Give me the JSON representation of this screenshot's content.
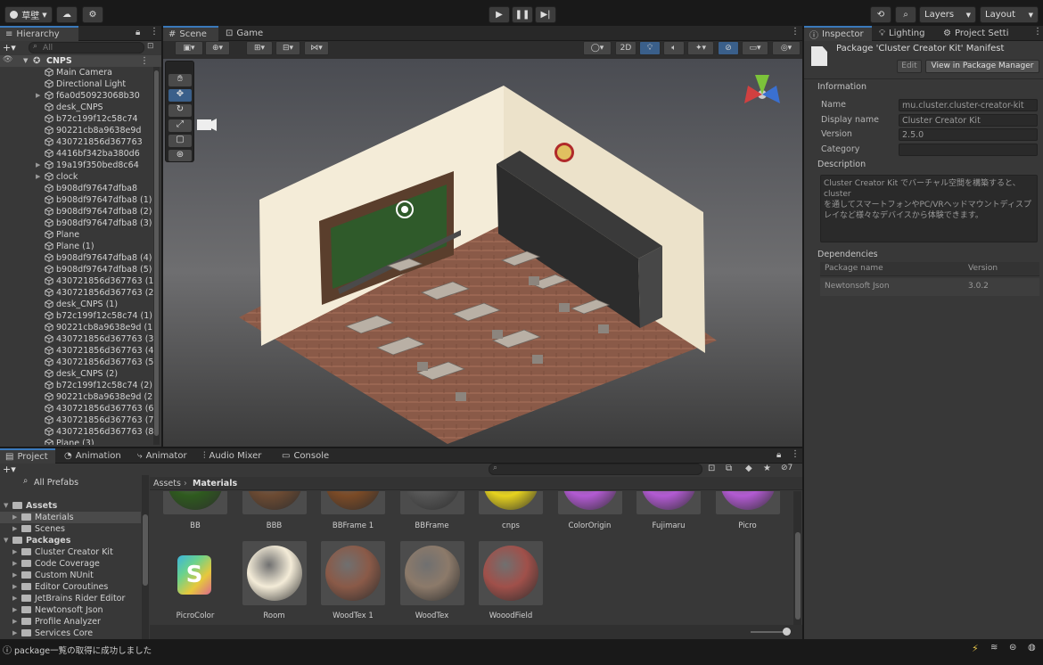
{
  "toolbar": {
    "account_label": "草壁",
    "layers_label": "Layers",
    "layout_label": "Layout"
  },
  "hierarchy": {
    "tab": "Hierarchy",
    "search_placeholder": "All",
    "root": "CNPS",
    "items": [
      {
        "label": "Main Camera",
        "expandable": false
      },
      {
        "label": "Directional Light",
        "expandable": false
      },
      {
        "label": "f6a0d50923068b30",
        "expandable": true
      },
      {
        "label": "desk_CNPS",
        "expandable": false
      },
      {
        "label": "b72c199f12c58c74",
        "expandable": false
      },
      {
        "label": "90221cb8a9638e9d",
        "expandable": false
      },
      {
        "label": "430721856d367763",
        "expandable": false
      },
      {
        "label": "4416bf342ba380d6",
        "expandable": false
      },
      {
        "label": "19a19f350bed8c64",
        "expandable": true
      },
      {
        "label": "clock",
        "expandable": true
      },
      {
        "label": "b908df97647dfba8",
        "expandable": false
      },
      {
        "label": "b908df97647dfba8 (1)",
        "expandable": false
      },
      {
        "label": "b908df97647dfba8 (2)",
        "expandable": false
      },
      {
        "label": "b908df97647dfba8 (3)",
        "expandable": false
      },
      {
        "label": "Plane",
        "expandable": false
      },
      {
        "label": "Plane (1)",
        "expandable": false
      },
      {
        "label": "b908df97647dfba8 (4)",
        "expandable": false
      },
      {
        "label": "b908df97647dfba8 (5)",
        "expandable": false
      },
      {
        "label": "430721856d367763 (1",
        "expandable": false
      },
      {
        "label": "430721856d367763 (2",
        "expandable": false
      },
      {
        "label": "desk_CNPS (1)",
        "expandable": false
      },
      {
        "label": "b72c199f12c58c74 (1)",
        "expandable": false
      },
      {
        "label": "90221cb8a9638e9d (1)",
        "expandable": false
      },
      {
        "label": "430721856d367763 (3",
        "expandable": false
      },
      {
        "label": "430721856d367763 (4",
        "expandable": false
      },
      {
        "label": "430721856d367763 (5",
        "expandable": false
      },
      {
        "label": "desk_CNPS (2)",
        "expandable": false
      },
      {
        "label": "b72c199f12c58c74 (2)",
        "expandable": false
      },
      {
        "label": "90221cb8a9638e9d (2)",
        "expandable": false
      },
      {
        "label": "430721856d367763 (6",
        "expandable": false
      },
      {
        "label": "430721856d367763 (7",
        "expandable": false
      },
      {
        "label": "430721856d367763 (8",
        "expandable": false
      },
      {
        "label": "Plane (3)",
        "expandable": false
      }
    ]
  },
  "scene": {
    "tab_scene": "Scene",
    "tab_game": "Game",
    "mode_2d": "2D"
  },
  "inspector": {
    "tabs": [
      "Inspector",
      "Lighting",
      "Project Setti"
    ],
    "title": "Package 'Cluster Creator Kit' Manifest",
    "edit_label": "Edit",
    "view_pm_label": "View in Package Manager",
    "information_header": "Information",
    "fields": [
      {
        "key": "Name",
        "value": "mu.cluster.cluster-creator-kit"
      },
      {
        "key": "Display name",
        "value": "Cluster Creator Kit"
      },
      {
        "key": "Version",
        "value": "2.5.0"
      },
      {
        "key": "Category",
        "value": ""
      }
    ],
    "description_header": "Description",
    "description_text": "Cluster Creator Kit でバーチャル空間を構築すると、cluster\nを通してスマートフォンやPC/VRヘッドマウントディスプレイなど様々なデバイスから体験できます。",
    "dependencies_header": "Dependencies",
    "dep_col_name": "Package name",
    "dep_col_version": "Version",
    "dependencies": [
      {
        "name": "Newtonsoft Json",
        "version": "3.0.2"
      }
    ]
  },
  "bottom": {
    "tabs": [
      "Project",
      "Animation",
      "Animator",
      "Audio Mixer",
      "Console"
    ],
    "hidden_count": "7",
    "breadcrumb_root": "Assets",
    "breadcrumb_leaf": "Materials",
    "tree": [
      {
        "label": "All Prefabs",
        "level": 1,
        "type": "search"
      },
      {
        "label": "Assets",
        "level": 0,
        "type": "folder-open",
        "bold": true
      },
      {
        "label": "Materials",
        "level": 1,
        "type": "folder",
        "selected": true
      },
      {
        "label": "Scenes",
        "level": 1,
        "type": "folder"
      },
      {
        "label": "Packages",
        "level": 0,
        "type": "folder-open",
        "bold": true
      },
      {
        "label": "Cluster Creator Kit",
        "level": 1,
        "type": "folder"
      },
      {
        "label": "Code Coverage",
        "level": 1,
        "type": "folder"
      },
      {
        "label": "Custom NUnit",
        "level": 1,
        "type": "folder"
      },
      {
        "label": "Editor Coroutines",
        "level": 1,
        "type": "folder"
      },
      {
        "label": "JetBrains Rider Editor",
        "level": 1,
        "type": "folder"
      },
      {
        "label": "Newtonsoft Json",
        "level": 1,
        "type": "folder"
      },
      {
        "label": "Profile Analyzer",
        "level": 1,
        "type": "folder"
      },
      {
        "label": "Services Core",
        "level": 1,
        "type": "folder"
      }
    ],
    "assets_row1": [
      {
        "label": "BB",
        "color": "#2e5a1e"
      },
      {
        "label": "BBB",
        "color": "#6b4a32"
      },
      {
        "label": "BBFrame 1",
        "color": "#7a4a26"
      },
      {
        "label": "BBFrame",
        "color": "#555555"
      },
      {
        "label": "cnps",
        "color": "#e6d21e"
      },
      {
        "label": "ColorOrigin",
        "color": "#b25ad2"
      },
      {
        "label": "Fujimaru",
        "color": "#b25ad2"
      },
      {
        "label": "Picro",
        "color": "#b25ad2"
      }
    ],
    "assets_row2": [
      {
        "label": "PicroColor",
        "color": "#3ca0dc"
      },
      {
        "label": "Room",
        "color": "#f4ecd8"
      },
      {
        "label": "WoodTex 1",
        "color": "#8a5a48"
      },
      {
        "label": "WoodTex",
        "color": "#8c7a6a"
      },
      {
        "label": "WooodField",
        "color": "#a0504a"
      }
    ]
  },
  "status": {
    "message": "package一覧の取得に成功しました"
  },
  "colors": {
    "accent": "#3a79bb",
    "panel": "#383838",
    "wall": "#f4ecd8",
    "floor": "#8a5a48",
    "board": "#2f5a2a"
  }
}
